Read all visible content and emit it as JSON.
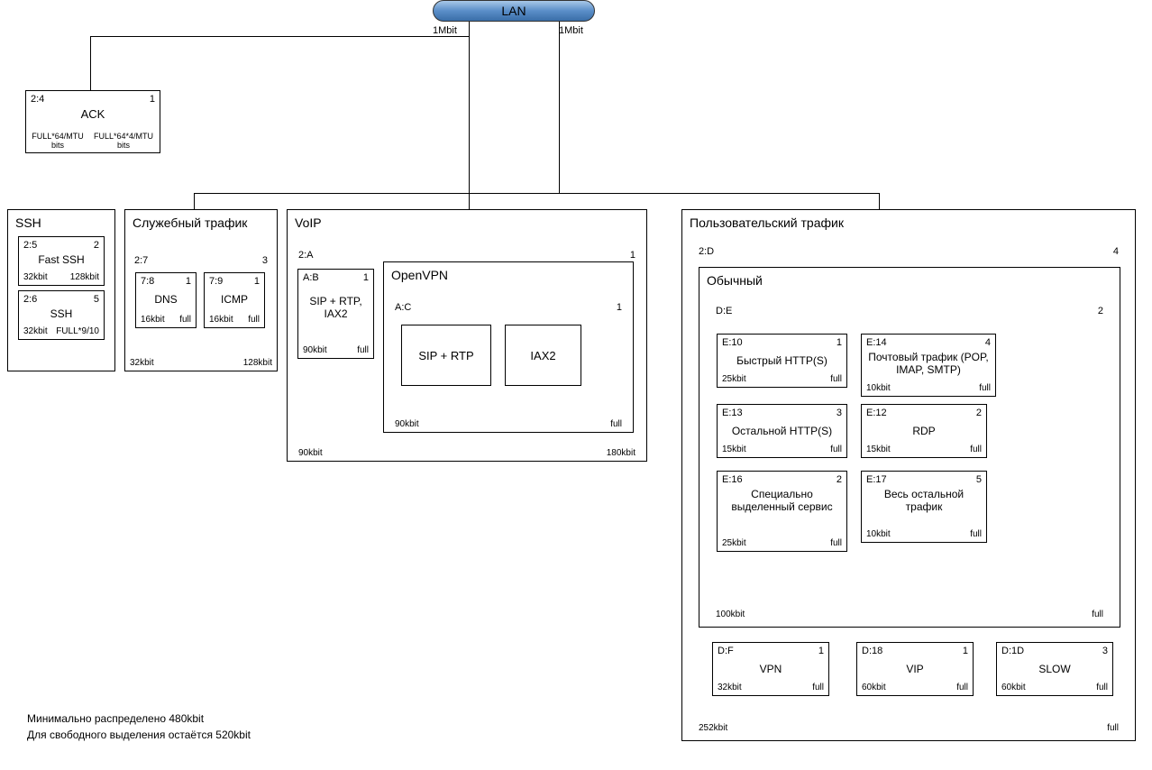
{
  "lan": {
    "label": "LAN",
    "left_rate": "1Mbit",
    "right_rate": "1Mbit"
  },
  "ack": {
    "id": "2:4",
    "prio": "1",
    "name": "ACK",
    "bl": "FULL*64/MTU bits",
    "br": "FULL*64*4/MTU bits"
  },
  "ssh_container": {
    "title": "SSH"
  },
  "fast_ssh": {
    "id": "2:5",
    "prio": "2",
    "name": "Fast SSH",
    "bl": "32kbit",
    "br": "128kbit"
  },
  "ssh": {
    "id": "2:6",
    "prio": "5",
    "name": "SSH",
    "bl": "32kbit",
    "br": "FULL*9/10"
  },
  "service_container": {
    "title": "Служебный трафик",
    "id": "2:7",
    "prio": "3",
    "bl": "32kbit",
    "br": "128kbit"
  },
  "dns": {
    "id": "7:8",
    "prio": "1",
    "name": "DNS",
    "bl": "16kbit",
    "br": "full"
  },
  "icmp": {
    "id": "7:9",
    "prio": "1",
    "name": "ICMP",
    "bl": "16kbit",
    "br": "full"
  },
  "voip_container": {
    "title": "VoIP",
    "id": "2:A",
    "prio": "1",
    "bl": "90kbit",
    "br": "180kbit"
  },
  "sip_rtp_iax2": {
    "id": "A:B",
    "prio": "1",
    "name": "SIP + RTP, IAX2",
    "bl": "90kbit",
    "br": "full"
  },
  "openvpn": {
    "title": "OpenVPN",
    "id": "A:C",
    "prio": "1",
    "bl": "90kbit",
    "br": "full"
  },
  "sip_rtp": {
    "name": "SIP + RTP"
  },
  "iax2": {
    "name": "IAX2"
  },
  "user_container": {
    "title": "Пользовательский трафик",
    "id": "2:D",
    "prio": "4",
    "bl": "252kbit",
    "br": "full"
  },
  "normal": {
    "title": "Обычный",
    "id": "D:E",
    "prio": "2",
    "bl": "100kbit",
    "br": "full"
  },
  "fast_http": {
    "id": "E:10",
    "prio": "1",
    "name": "Быстрый HTTP(S)",
    "bl": "25kbit",
    "br": "full"
  },
  "mail": {
    "id": "E:14",
    "prio": "4",
    "name": "Почтовый трафик (POP, IMAP, SMTP)",
    "bl": "10kbit",
    "br": "full"
  },
  "rest_http": {
    "id": "E:13",
    "prio": "3",
    "name": "Остальной HTTP(S)",
    "bl": "15kbit",
    "br": "full"
  },
  "rdp": {
    "id": "E:12",
    "prio": "2",
    "name": "RDP",
    "bl": "15kbit",
    "br": "full"
  },
  "special": {
    "id": "E:16",
    "prio": "2",
    "name": "Специально выделенный сервис",
    "bl": "25kbit",
    "br": "full"
  },
  "rest_all": {
    "id": "E:17",
    "prio": "5",
    "name": "Весь остальной трафик",
    "bl": "10kbit",
    "br": "full"
  },
  "vpn": {
    "id": "D:F",
    "prio": "1",
    "name": "VPN",
    "bl": "32kbit",
    "br": "full"
  },
  "vip": {
    "id": "D:18",
    "prio": "1",
    "name": "VIP",
    "bl": "60kbit",
    "br": "full"
  },
  "slow": {
    "id": "D:1D",
    "prio": "3",
    "name": "SLOW",
    "bl": "60kbit",
    "br": "full"
  },
  "footer": {
    "line1": "Минимально распределено 480kbit",
    "line2": "Для свободного выделения остаётся 520kbit"
  }
}
